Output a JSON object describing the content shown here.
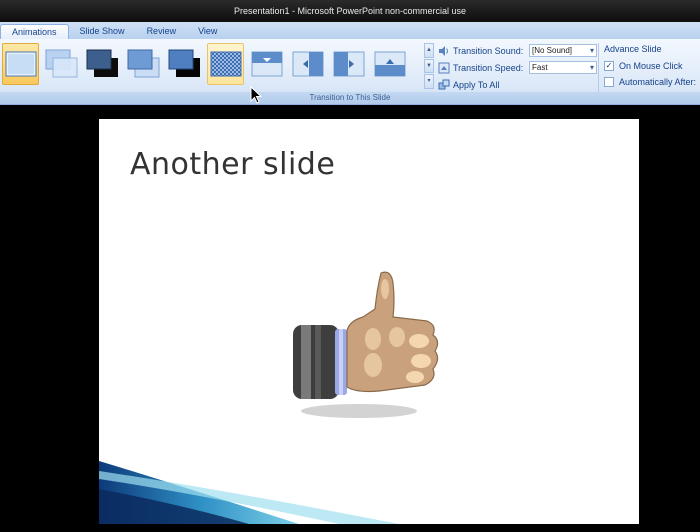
{
  "window": {
    "title": "Presentation1 - Microsoft PowerPoint non-commercial use"
  },
  "tabs": [
    {
      "label": "Animations",
      "active": true
    },
    {
      "label": "Slide Show",
      "active": false
    },
    {
      "label": "Review",
      "active": false
    },
    {
      "label": "View",
      "active": false
    }
  ],
  "ribbon": {
    "group_label": "Transition to This Slide",
    "transition_sound": {
      "label": "Transition Sound:",
      "value": "[No Sound]"
    },
    "transition_speed": {
      "label": "Transition Speed:",
      "value": "Fast"
    },
    "apply_to_all": "Apply To All",
    "advance": {
      "header": "Advance Slide",
      "on_mouse_click": {
        "label": "On Mouse Click",
        "checked": true
      },
      "automatically_after": {
        "label": "Automatically After:",
        "checked": false
      }
    },
    "gallery_icons": [
      "no-transition-icon",
      "fade-smoothly-icon",
      "fade-through-black-icon",
      "cut-icon",
      "cut-through-black-icon",
      "dissolve-icon",
      "wipe-down-icon",
      "wipe-left-icon",
      "wipe-right-icon",
      "wipe-up-icon"
    ]
  },
  "slide": {
    "title": "Another slide"
  },
  "colors": {
    "accent": "#15428b",
    "selected": "#f7c95c",
    "ribbon": "#dde9f8"
  }
}
